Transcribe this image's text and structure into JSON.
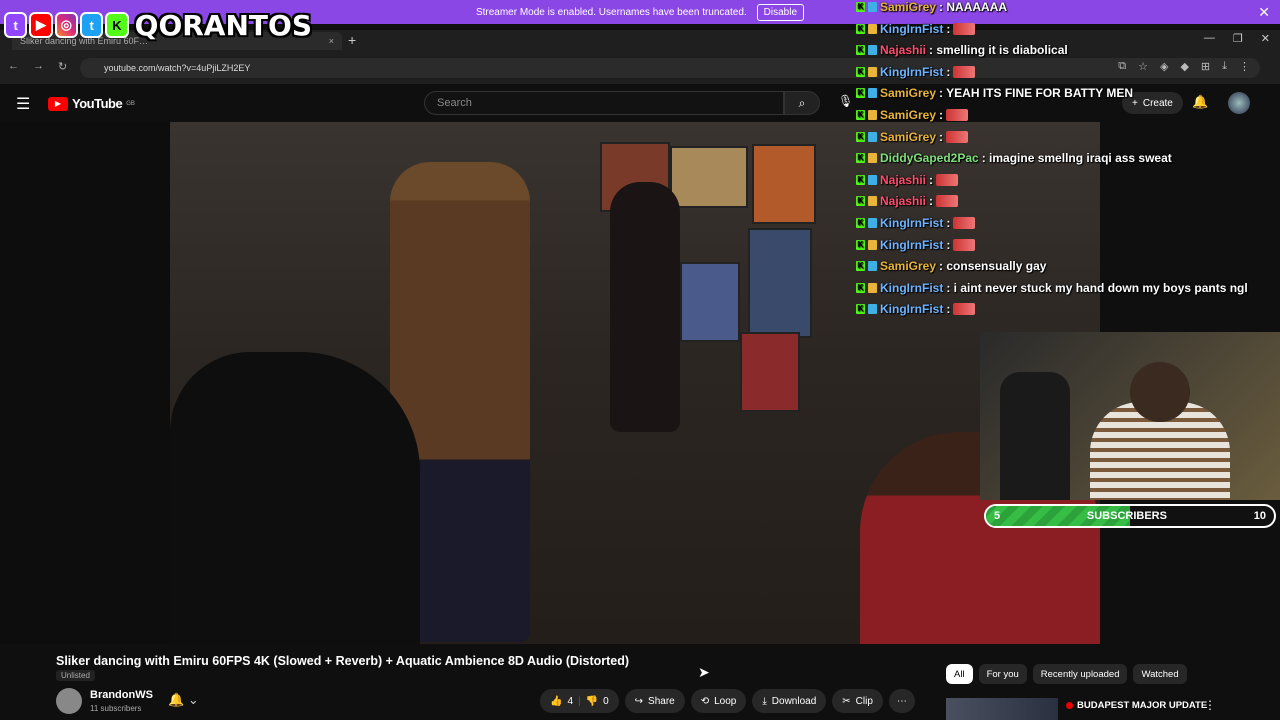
{
  "banner": {
    "text": "Streamer Mode is enabled. Usernames have been truncated.",
    "button": "Disable",
    "close": "✕"
  },
  "overlay": {
    "brand": "QORANTOS"
  },
  "browser": {
    "tab_title": "Sliker dancing with Emiru 60F…",
    "tab_close": "×",
    "new_tab": "+",
    "url": "youtube.com/watch?v=4uPjiLZH2EY"
  },
  "youtube": {
    "logo": "YouTube",
    "region": "GB",
    "search_placeholder": "Search",
    "create_label": "Create"
  },
  "chat": [
    {
      "user": "SamiGrey",
      "text": ": NAAAAAA",
      "color": "#e8b43a",
      "emote": false
    },
    {
      "user": "KingIrnFist",
      "text": ":",
      "color": "#6fb4ff",
      "emote": true
    },
    {
      "user": "Najashii",
      "text": ": smelling it is diabolical",
      "color": "#ff4d6d",
      "emote": false
    },
    {
      "user": "KingIrnFist",
      "text": ":",
      "color": "#6fb4ff",
      "emote": true
    },
    {
      "user": "SamiGrey",
      "text": ": YEAH ITS FINE FOR BATTY MEN",
      "color": "#e8b43a",
      "emote": false
    },
    {
      "user": "SamiGrey",
      "text": ":",
      "color": "#e8b43a",
      "emote": true
    },
    {
      "user": "SamiGrey",
      "text": ":",
      "color": "#e8b43a",
      "emote": true
    },
    {
      "user": "DiddyGaped2Pac",
      "text": ": imagine smellng iraqi ass sweat",
      "color": "#7fe07a",
      "emote": false
    },
    {
      "user": "Najashii",
      "text": ":",
      "color": "#ff4d6d",
      "emote": true
    },
    {
      "user": "Najashii",
      "text": ":",
      "color": "#ff4d6d",
      "emote": true
    },
    {
      "user": "KingIrnFist",
      "text": ":",
      "color": "#6fb4ff",
      "emote": true
    },
    {
      "user": "KingIrnFist",
      "text": ":",
      "color": "#6fb4ff",
      "emote": true
    },
    {
      "user": "SamiGrey",
      "text": ": consensually gay",
      "color": "#e8b43a",
      "emote": false
    },
    {
      "user": "KingIrnFist",
      "text": ": i aint never stuck my hand down my boys pants ngl",
      "color": "#6fb4ff",
      "emote": false
    },
    {
      "user": "KingIrnFist",
      "text": ":",
      "color": "#6fb4ff",
      "emote": true
    }
  ],
  "subgoal": {
    "current": "5",
    "label": "SUBSCRIBERS",
    "target": "10",
    "progress": 0.5
  },
  "video": {
    "title": "Sliker dancing with Emiru 60FPS 4K (Slowed + Reverb) + Aquatic Ambience 8D Audio (Distorted)",
    "visibility": "Unlisted",
    "channel": "BrandonWS",
    "subscribers": "11 subscribers",
    "likes": "4",
    "dislikes": "0",
    "share": "Share",
    "loop": "Loop",
    "download": "Download",
    "clip": "Clip",
    "more": "⋯"
  },
  "chips": [
    "All",
    "For you",
    "Recently uploaded",
    "Watched"
  ],
  "recommendation": {
    "title": "BUDAPEST MAJOR UPDATE"
  },
  "colors": {
    "banner": "#8b47e6",
    "youtube_red": "#ff0000",
    "goal_green": "#36bd45"
  }
}
